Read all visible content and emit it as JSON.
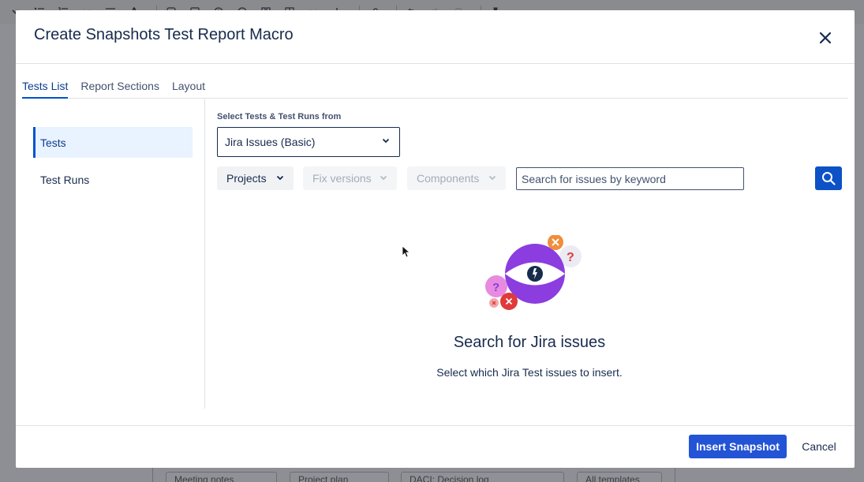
{
  "background": {
    "toolbar_letter": "A",
    "chips": [
      "Meeting notes",
      "Project plan",
      "DACI: Decision log",
      "All templates"
    ]
  },
  "modal": {
    "title": "Create Snapshots Test Report Macro",
    "close_icon": "close-icon",
    "tabs": [
      {
        "label": "Tests List",
        "active": true
      },
      {
        "label": "Report Sections",
        "active": false
      },
      {
        "label": "Layout",
        "active": false
      }
    ],
    "left_nav": [
      {
        "label": "Tests",
        "active": true
      },
      {
        "label": "Test Runs",
        "active": false
      }
    ],
    "source": {
      "label": "Select Tests & Test Runs from",
      "selected": "Jira Issues (Basic)"
    },
    "filters": {
      "projects": "Projects",
      "fix_versions": "Fix versions",
      "components": "Components"
    },
    "search": {
      "placeholder": "Search for issues by keyword",
      "value": ""
    },
    "empty_state": {
      "title": "Search for Jira issues",
      "description": "Select which Jira Test issues to insert."
    },
    "footer": {
      "primary": "Insert Snapshot",
      "secondary": "Cancel"
    }
  },
  "colors": {
    "primary": "#2454d6",
    "accent_purple": "#8b3ddf",
    "accent_orange": "#f18d3b",
    "accent_red": "#e03a3a",
    "accent_pink": "#e78be0"
  }
}
